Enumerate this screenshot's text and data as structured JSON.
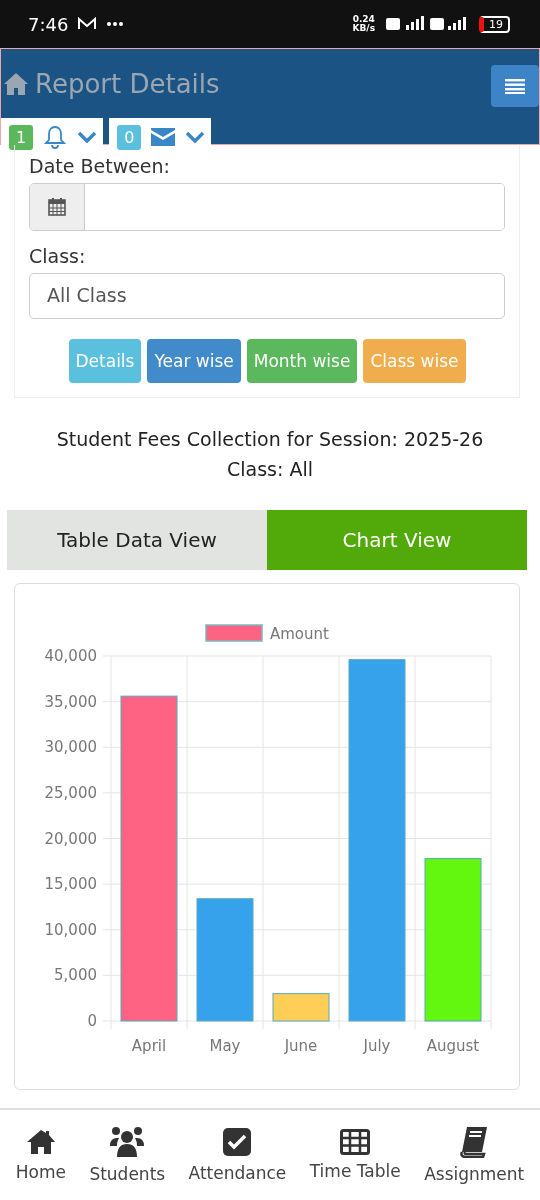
{
  "status_bar": {
    "time": "7:46",
    "speed": "0.24",
    "speed_unit": "KB/s",
    "battery": "19"
  },
  "header": {
    "title": "Report Details",
    "notifications": [
      {
        "kind": "bell",
        "count": "1",
        "color": "#5cb85c"
      },
      {
        "kind": "mail",
        "count": "0",
        "color": "#5bc0de"
      }
    ]
  },
  "filters": {
    "date_label": "Date Between:",
    "class_label": "Class:",
    "class_value": "All Class",
    "buttons": [
      {
        "label": "Details",
        "color": "#5bc0de"
      },
      {
        "label": "Year wise",
        "color": "#428bca"
      },
      {
        "label": "Month wise",
        "color": "#5cb85c"
      },
      {
        "label": "Class wise",
        "color": "#f0ad4e"
      }
    ]
  },
  "report_title": "Student Fees Collection for Session: 2025-26",
  "report_subtitle": "Class: All",
  "tabs": [
    {
      "label": "Table Data View",
      "selected": false
    },
    {
      "label": "Chart View",
      "selected": true
    }
  ],
  "chart": {
    "chart_data": {
      "type": "bar",
      "categories": [
        "April",
        "May",
        "June",
        "July",
        "August"
      ],
      "series": [
        {
          "name": "Amount",
          "colors": [
            "#ff6384",
            "#36a2eb",
            "#ffce56",
            "#36a2eb",
            "#63f70f"
          ],
          "values": [
            35600,
            13400,
            3000,
            39600,
            17800
          ]
        }
      ],
      "ylim": [
        0,
        40000
      ],
      "grid": true,
      "yticks": [
        {
          "value": 0,
          "label": "0"
        },
        {
          "value": 5000,
          "label": "5,000"
        },
        {
          "value": 10000,
          "label": "10,000"
        },
        {
          "value": 15000,
          "label": "15,000"
        },
        {
          "value": 20000,
          "label": "20,000"
        },
        {
          "value": 25000,
          "label": "25,000"
        },
        {
          "value": 30000,
          "label": "30,000"
        },
        {
          "value": 35000,
          "label": "35,000"
        },
        {
          "value": 40000,
          "label": "40,000"
        }
      ]
    }
  },
  "bottom_nav": [
    {
      "kind": "home",
      "label": "Home"
    },
    {
      "kind": "users",
      "label": "Students"
    },
    {
      "kind": "check",
      "label": "Attendance"
    },
    {
      "kind": "table",
      "label": "Time Table"
    },
    {
      "kind": "book",
      "label": "Assignment"
    }
  ]
}
